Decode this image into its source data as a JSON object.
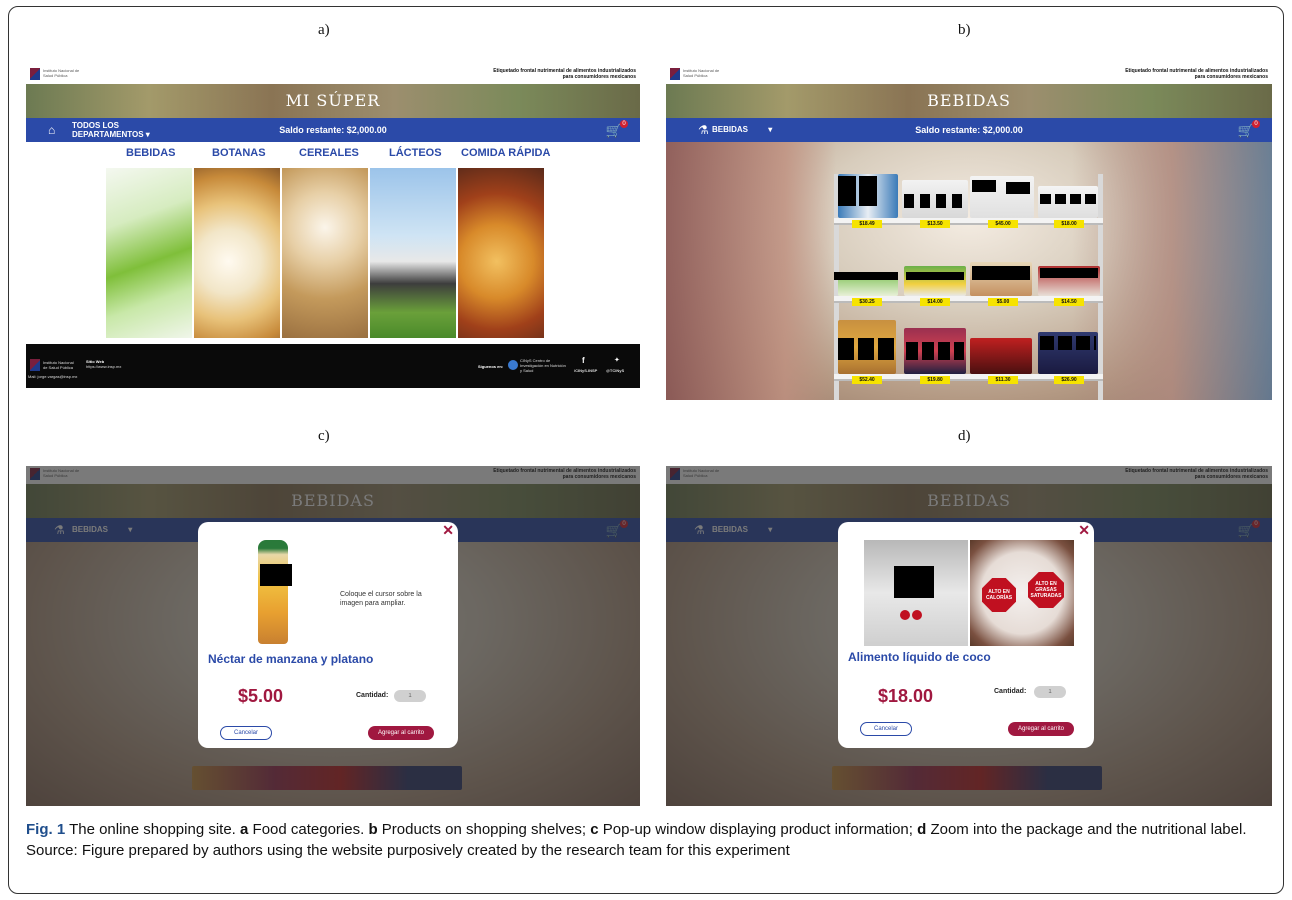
{
  "labels": {
    "a": "a)",
    "b": "b)",
    "c": "c)",
    "d": "d)"
  },
  "site": {
    "institute": "Instituto Nacional de Salud Pública",
    "tagline": "Etiquetado frontal nutrimental de alimentos industrializados para consumidores mexicanos",
    "balance": "Saldo restante: $2,000.00",
    "cart_count": "0"
  },
  "panel_a": {
    "banner_title": "MI SÚPER",
    "dept_selector": "TODOS LOS DEPARTAMENTOS",
    "categories": [
      "BEBIDAS",
      "BOTANAS",
      "CEREALES",
      "LÁCTEOS",
      "COMIDA RÁPIDA"
    ],
    "footer": {
      "institute": "Instituto Nacional de Salud Pública",
      "web_label": "Sitio Web",
      "web_url": "https://www.insp.mx",
      "email": "Mail: jorge.vargas@insp.mx",
      "follow": "Síguenos en:",
      "cinys": "CINyS Centro de Investigación en Nutrición y Salud",
      "facebook": "/CINyS.INSP",
      "twitter": "@TCINyS"
    }
  },
  "panel_b": {
    "banner_title": "BEBIDAS",
    "dept_selector": "BEBIDAS",
    "prices_top": [
      "$18.49",
      "$13.50",
      "$45.00",
      "$18.00"
    ],
    "prices_mid": [
      "$30.25",
      "$14.00",
      "$5.00",
      "$14.50"
    ],
    "prices_bot": [
      "$52.40",
      "$19.80",
      "$11.30",
      "$26.90"
    ]
  },
  "panel_c": {
    "hint": "Coloque el cursor sobre la imagen para ampliar.",
    "product_name": "Néctar de manzana y platano",
    "price": "$5.00",
    "qty_label": "Cantidad:",
    "qty_value": "1",
    "cancel": "Cancelar",
    "add": "Agregar al carrito"
  },
  "panel_d": {
    "product_name": "Alimento líquido de coco",
    "price": "$18.00",
    "qty_label": "Cantidad:",
    "qty_value": "1",
    "cancel": "Cancelar",
    "add": "Agregar al carrito",
    "seal_1": "ALTO EN CALORÍAS",
    "seal_2": "ALTO EN GRASAS SATURADAS"
  },
  "caption": {
    "fig": "Fig. 1",
    "t1": " The online shopping site. ",
    "a": "a",
    "ta": " Food categories. ",
    "b": "b",
    "tb": " Products on shopping shelves; ",
    "c": "c",
    "tc": " Pop-up window displaying product information; ",
    "d": "d",
    "td": " Zoom into the package and the nutritional label. Source: Figure prepared by authors using the website purposively created by the research team for this experiment"
  },
  "colors": {
    "brand_blue": "#2b4aa8",
    "brand_maroon": "#a01840",
    "price_tag": "#f6e300"
  }
}
